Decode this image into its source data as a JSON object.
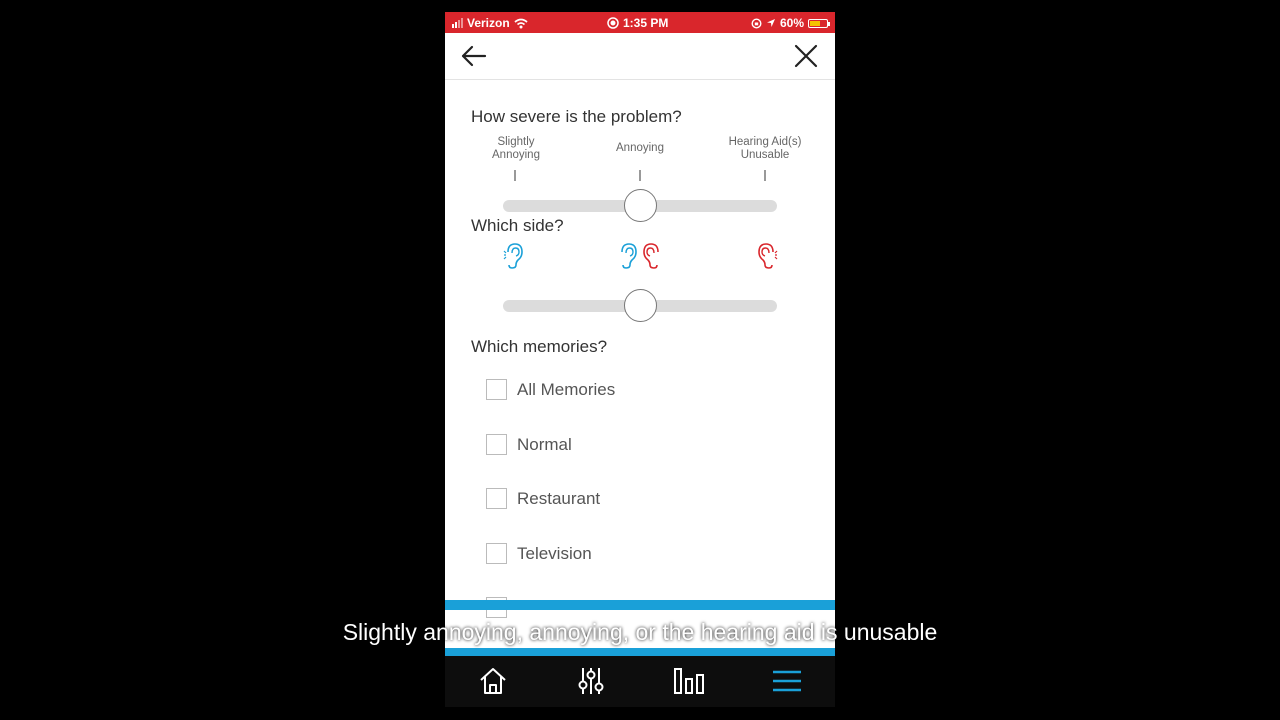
{
  "status": {
    "carrier": "Verizon",
    "time": "1:35 PM",
    "battery": "60%",
    "battery_level": 0.6
  },
  "severity": {
    "question": "How severe is the problem?",
    "labels": [
      {
        "line1": "Slightly",
        "line2": "Annoying"
      },
      {
        "line1": "Annoying",
        "line2": ""
      },
      {
        "line1": "Hearing Aid(s)",
        "line2": "Unusable"
      }
    ],
    "value": 0.5
  },
  "side": {
    "question": "Which side?",
    "value": 0.5,
    "left_color": "#1aa0d8",
    "right_color": "#d9262c"
  },
  "memories": {
    "question": "Which memories?",
    "options": [
      {
        "label": "All Memories",
        "checked": false
      },
      {
        "label": "Normal",
        "checked": false
      },
      {
        "label": "Restaurant",
        "checked": false
      },
      {
        "label": "Television",
        "checked": false
      }
    ]
  },
  "caption": "Slightly annoying, annoying, or the hearing aid is unusable",
  "tabs": [
    "home-icon",
    "sliders-icon",
    "bar-chart-icon",
    "menu-icon"
  ],
  "colors": {
    "accent": "#1aa0d8",
    "status_bar": "#d9262c"
  }
}
